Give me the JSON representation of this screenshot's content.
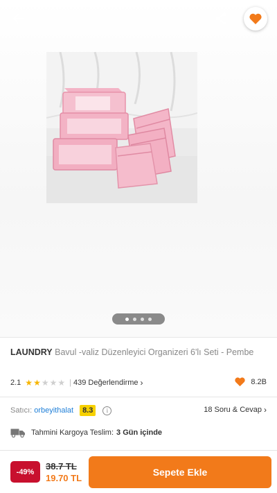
{
  "header": {
    "back_icon": "arrow-left-icon",
    "share_icon": "share-icon",
    "favorite_icon": "heart-icon"
  },
  "gallery": {
    "image_alt": "pink travel bag organizer set",
    "page_count": 4,
    "active_page": 1
  },
  "product": {
    "brand": "LAUNDRY",
    "name": "Bavul -valiz Düzenleyici Organizeri 6'lı Seti - Pembe",
    "rating": "2.1",
    "stars_filled": 2,
    "stars_total": 5,
    "review_count_label": "439 Değerlendirme",
    "favorite_count": "8.2B"
  },
  "seller": {
    "label": "Satıcı:",
    "name": "orbeyithalat",
    "score": "8.3",
    "qa_label": "18 Soru & Cevap"
  },
  "shipping": {
    "label": "Tahmini Kargoya Teslim:",
    "days": "3 Gün içinde"
  },
  "purchase": {
    "discount": "-49%",
    "old_price": "38.7 TL",
    "new_price": "19.70 TL",
    "add_to_cart_label": "Sepete Ekle"
  },
  "colors": {
    "accent": "#f27a1a",
    "discount_badge": "#c8102e",
    "seller_score_bg": "#f7d100",
    "link": "#1f7fd8",
    "star": "#f7b500"
  }
}
